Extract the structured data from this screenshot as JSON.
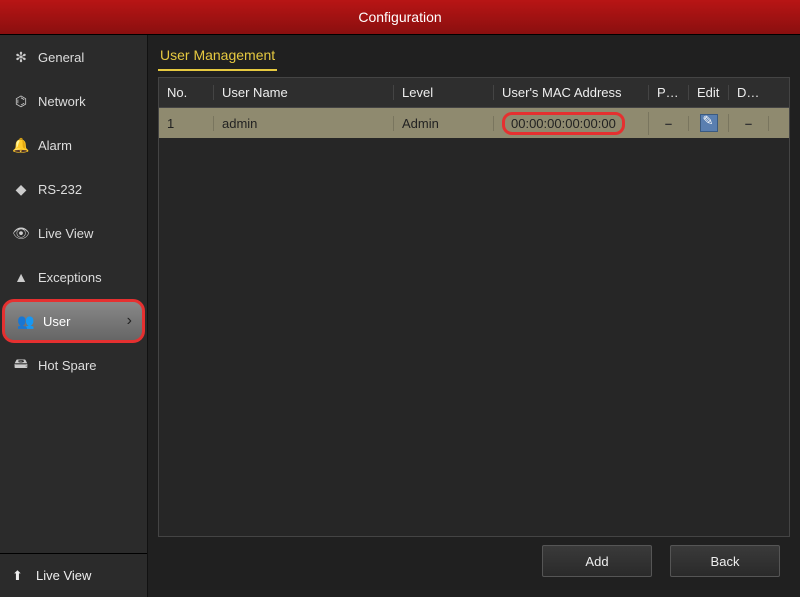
{
  "title": "Configuration",
  "page_title": "User Management",
  "sidebar": {
    "items": [
      {
        "label": "General",
        "icon": "✻"
      },
      {
        "label": "Network",
        "icon": "⌬"
      },
      {
        "label": "Alarm",
        "icon": "🔔"
      },
      {
        "label": "RS-232",
        "icon": "◆"
      },
      {
        "label": "Live View",
        "icon": "👁"
      },
      {
        "label": "Exceptions",
        "icon": "▲"
      },
      {
        "label": "User",
        "icon": "👥"
      },
      {
        "label": "Hot Spare",
        "icon": "🖴"
      }
    ],
    "bottom": {
      "label": "Live View",
      "icon": "⬆"
    }
  },
  "table": {
    "headers": {
      "no": "No.",
      "user_name": "User Name",
      "level": "Level",
      "mac": "User's MAC Address",
      "pe": "Pe...",
      "edit": "Edit",
      "del": "Del..."
    },
    "rows": [
      {
        "no": "1",
        "user_name": "admin",
        "level": "Admin",
        "mac": "00:00:00:00:00:00",
        "pe": "–",
        "del": "–"
      }
    ]
  },
  "footer": {
    "add": "Add",
    "back": "Back"
  }
}
